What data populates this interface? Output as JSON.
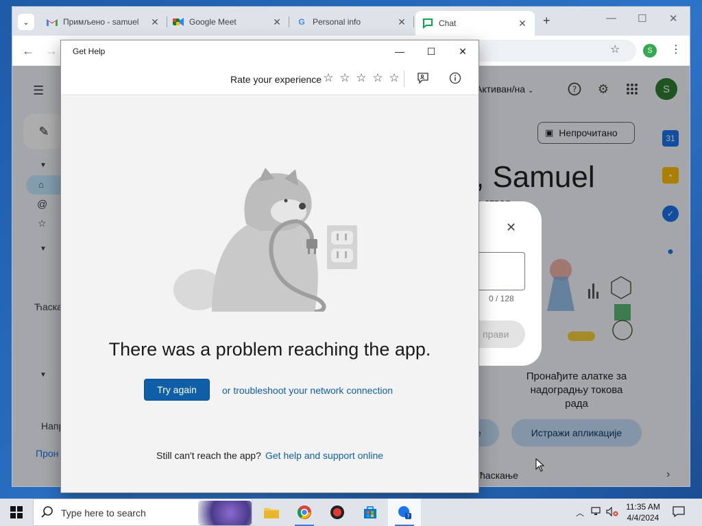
{
  "browser": {
    "tabs": [
      {
        "title": "Примљено - samuel",
        "favicon": "gmail-icon"
      },
      {
        "title": "Google Meet",
        "favicon": "meet-icon"
      },
      {
        "title": "Personal info",
        "favicon": "google-icon"
      },
      {
        "title": "Chat",
        "favicon": "chat-icon",
        "active": true
      }
    ],
    "profile_initial": "S",
    "accent": "#34a853"
  },
  "chat_page": {
    "status": "Активан/на",
    "unread_chip": "Непрочитано",
    "greeting": ", Samuel",
    "greeting_sub": "а ствар.",
    "rail_section": "Ћаска",
    "rail_nap": "Напр",
    "rail_link": "Прон",
    "avatar_initial": "S",
    "dialog_count": "0 / 128",
    "dialog_send": "прави",
    "find_tools": "Пронађите алатке за надоградњу токова рада",
    "partial_button": "е",
    "explore_button": "Истражи апликације",
    "bottom_chat": "ћаскање"
  },
  "get_help": {
    "title": "Get Help",
    "rate_label": "Rate your experience",
    "rating": 0,
    "rating_max": 5,
    "error_message": "There was a problem reaching the app.",
    "try_again": "Try again",
    "troubleshoot": "or troubleshoot your network connection",
    "still_cant": "Still can't reach the app?",
    "help_online": "Get help and support online",
    "link_color": "#0f5fa8"
  },
  "taskbar": {
    "search_placeholder": "Type here to search",
    "time": "11:35 AM",
    "date": "4/4/2024"
  }
}
